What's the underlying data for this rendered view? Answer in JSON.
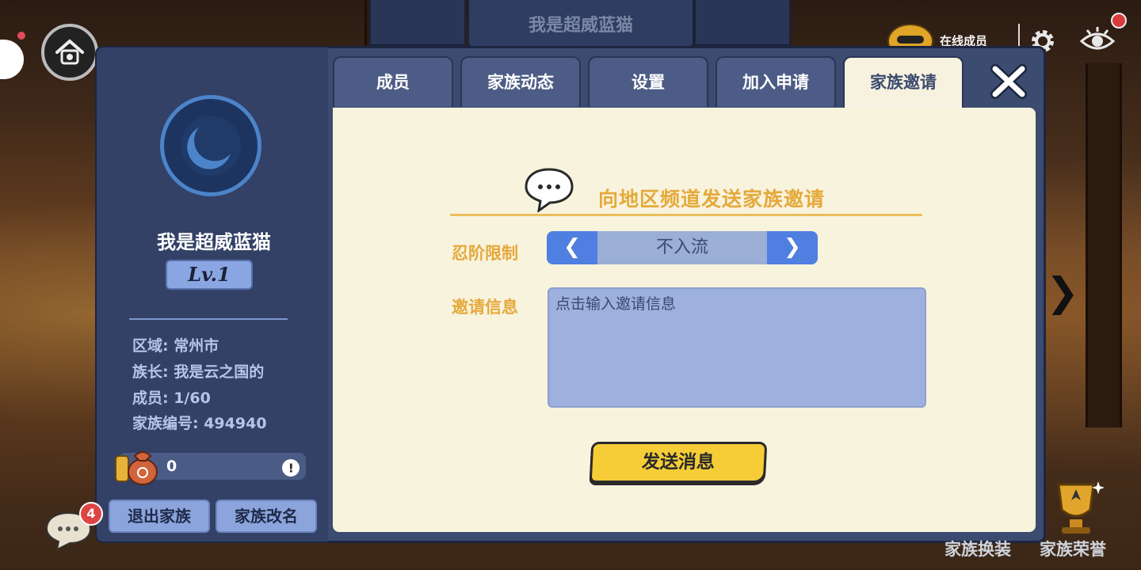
{
  "banner": {
    "family_name": "我是超威蓝猫"
  },
  "hud": {
    "online_label": "在线成员"
  },
  "left": {
    "family_name": "我是超威蓝猫",
    "level": "Lv.1",
    "region": "区域: 常州市",
    "leader": "族长: 我是云之国的",
    "members": "成员: 1/60",
    "family_id": "家族编号: 494940",
    "funds": "0",
    "quit_button": "退出家族",
    "rename_button": "家族改名"
  },
  "tabs": [
    {
      "label": "成员"
    },
    {
      "label": "家族动态"
    },
    {
      "label": "设置"
    },
    {
      "label": "加入申请"
    },
    {
      "label": "家族邀请"
    }
  ],
  "invite": {
    "title": "向地区频道发送家族邀请",
    "rank_label": "忍阶限制",
    "rank_value": "不入流",
    "message_label": "邀请信息",
    "message_placeholder": "点击输入邀请信息",
    "send_button": "发送消息"
  },
  "bottom": {
    "chat_badge": "4",
    "outfit_label": "家族换装",
    "honor_label": "家族荣誉"
  }
}
